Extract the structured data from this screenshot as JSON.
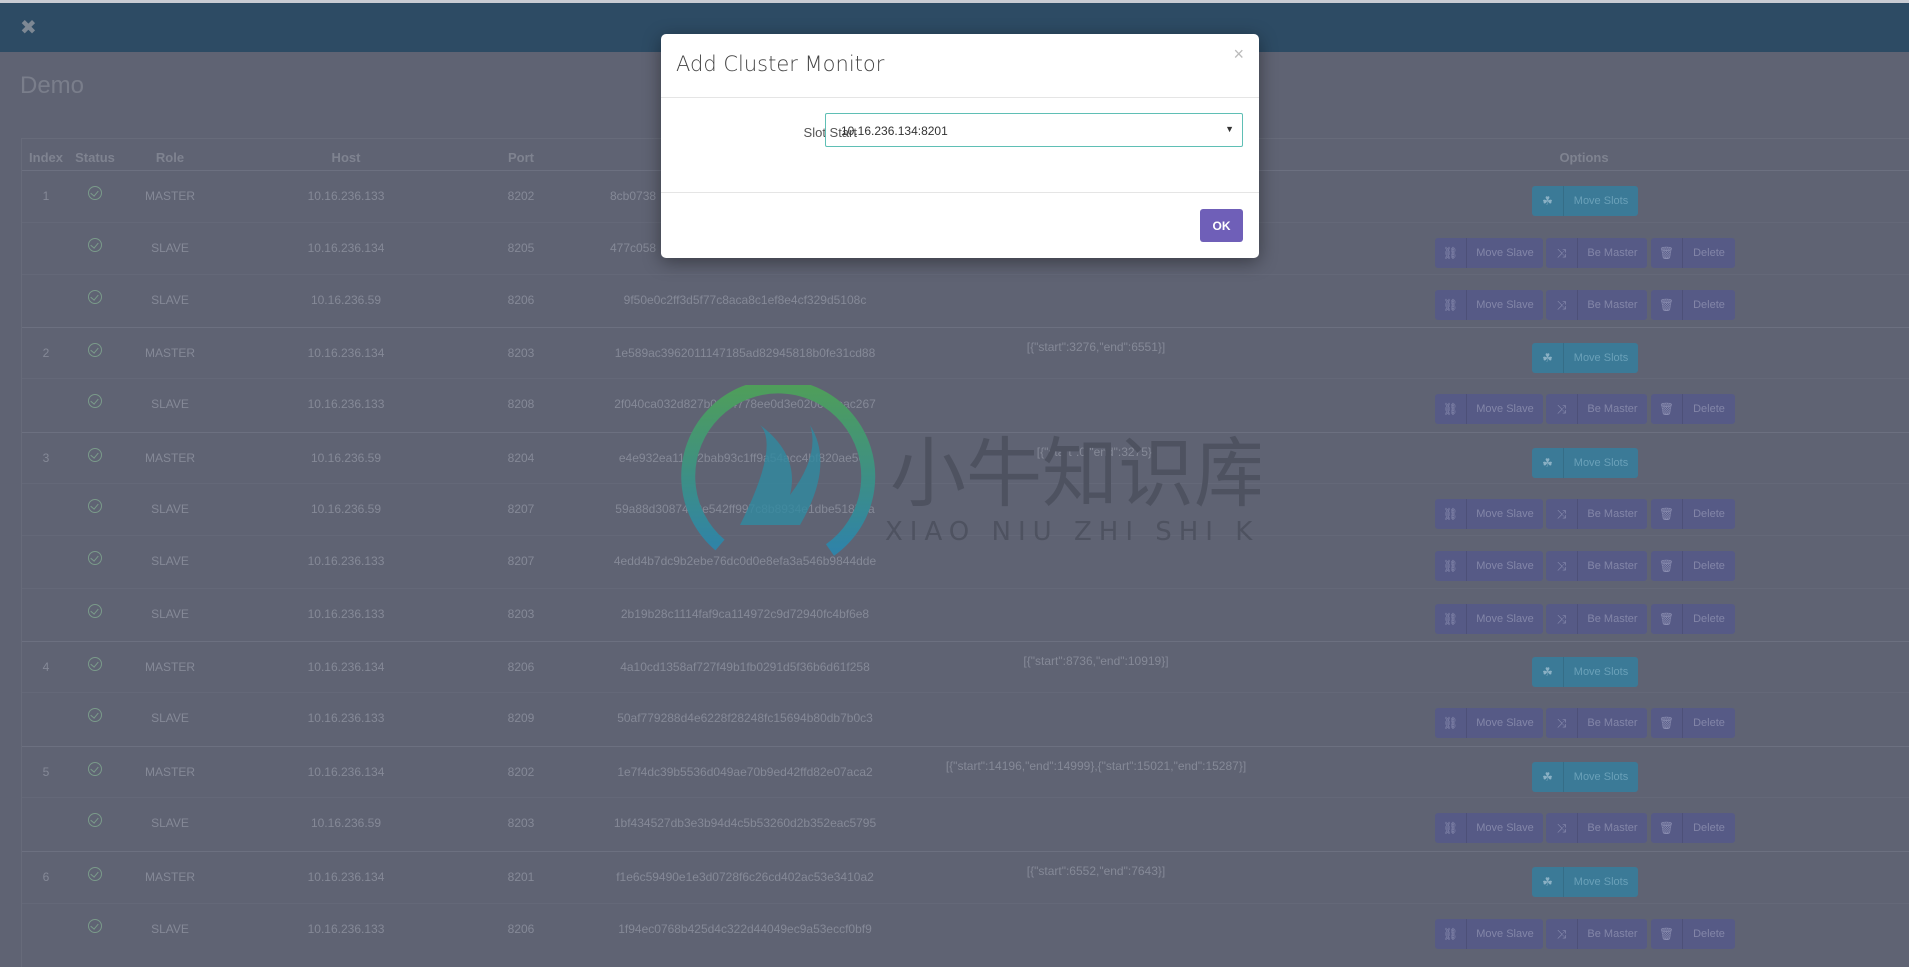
{
  "app": {
    "title": "Demo",
    "logo_icon": "joomla-like-logo"
  },
  "table": {
    "headers": {
      "index": "Index",
      "status": "Status",
      "role": "Role",
      "host": "Host",
      "port": "Port",
      "options": "Options"
    },
    "rows": [
      {
        "index": "1",
        "role": "MASTER",
        "host": "10.16.236.133",
        "port": "8202",
        "node_id": "8cb0738",
        "slots": "",
        "status": "ok"
      },
      {
        "index": "",
        "role": "SLAVE",
        "host": "10.16.236.134",
        "port": "8205",
        "node_id": "477c058",
        "slots": "",
        "status": "ok"
      },
      {
        "index": "",
        "role": "SLAVE",
        "host": "10.16.236.59",
        "port": "8206",
        "node_id": "9f50e0c2ff3d5f77c8aca8c1ef8e4cf329d5108c",
        "slots": "",
        "status": "ok"
      },
      {
        "index": "2",
        "role": "MASTER",
        "host": "10.16.236.134",
        "port": "8203",
        "node_id": "1e589ac3962011147185ad82945818b0fe31cd88",
        "slots": "[{\"start\":3276,\"end\":6551}]",
        "status": "ok"
      },
      {
        "index": "",
        "role": "SLAVE",
        "host": "10.16.236.133",
        "port": "8208",
        "node_id": "2f040ca032d827b0e44778ee0d3e020c42eac267",
        "slots": "",
        "status": "ok"
      },
      {
        "index": "3",
        "role": "MASTER",
        "host": "10.16.236.59",
        "port": "8204",
        "node_id": "e4e932ea111b2bab93c1ff9a54acc4bf820ae50c",
        "slots": "[{\"start\":0,\"end\":3275}]",
        "status": "ok"
      },
      {
        "index": "",
        "role": "SLAVE",
        "host": "10.16.236.59",
        "port": "8207",
        "node_id": "59a88d3087420e542ff997c8b8934e1dbe5185aa",
        "slots": "",
        "status": "ok"
      },
      {
        "index": "",
        "role": "SLAVE",
        "host": "10.16.236.133",
        "port": "8207",
        "node_id": "4edd4b7dc9b2ebe76dc0d0e8efa3a546b9844dde",
        "slots": "",
        "status": "ok"
      },
      {
        "index": "",
        "role": "SLAVE",
        "host": "10.16.236.133",
        "port": "8203",
        "node_id": "2b19b28c1114faf9ca114972c9d72940fc4bf6e8",
        "slots": "",
        "status": "ok"
      },
      {
        "index": "4",
        "role": "MASTER",
        "host": "10.16.236.134",
        "port": "8206",
        "node_id": "4a10cd1358af727f49b1fb0291d5f36b6d61f258",
        "slots": "[{\"start\":8736,\"end\":10919}]",
        "status": "ok"
      },
      {
        "index": "",
        "role": "SLAVE",
        "host": "10.16.236.133",
        "port": "8209",
        "node_id": "50af779288d4e6228f28248fc15694b80db7b0c3",
        "slots": "",
        "status": "ok"
      },
      {
        "index": "5",
        "role": "MASTER",
        "host": "10.16.236.134",
        "port": "8202",
        "node_id": "1e7f4dc39b5536d049ae70b9ed42ffd82e07aca2",
        "slots": "[{\"start\":14196,\"end\":14999},{\"start\":15021,\"end\":15287}]",
        "status": "ok"
      },
      {
        "index": "",
        "role": "SLAVE",
        "host": "10.16.236.59",
        "port": "8203",
        "node_id": "1bf434527db3e3b94d4c5b53260d2b352eac5795",
        "slots": "",
        "status": "ok"
      },
      {
        "index": "6",
        "role": "MASTER",
        "host": "10.16.236.134",
        "port": "8201",
        "node_id": "f1e6c59490e1e3d0728f6c26cd402ac53e3410a2",
        "slots": "[{\"start\":6552,\"end\":7643}]",
        "status": "ok"
      },
      {
        "index": "",
        "role": "SLAVE",
        "host": "10.16.236.133",
        "port": "8206",
        "node_id": "1f94ec0768b425d4c322d44049ec9a53eccf0bf9",
        "slots": "",
        "status": "ok"
      }
    ],
    "buttons": {
      "move_slots": "Move Slots",
      "move_slave": "Move Slave",
      "be_master": "Be Master",
      "delete": "Delete"
    }
  },
  "modal": {
    "title": "Add Cluster Monitor",
    "close": "×",
    "field_label": "Slot Start",
    "select_value": "10.16.236.134:8201",
    "ok_label": "OK"
  },
  "watermark": {
    "cn": "小牛知识库",
    "en": "XIAO NIU ZHI SHI KU"
  },
  "colors": {
    "navbar": "#2d4b64",
    "ok_button": "#6f5fb8",
    "move_slots": "#3b7a97",
    "slave_buttons": "#565a86",
    "select_border": "#5fbfb5"
  }
}
